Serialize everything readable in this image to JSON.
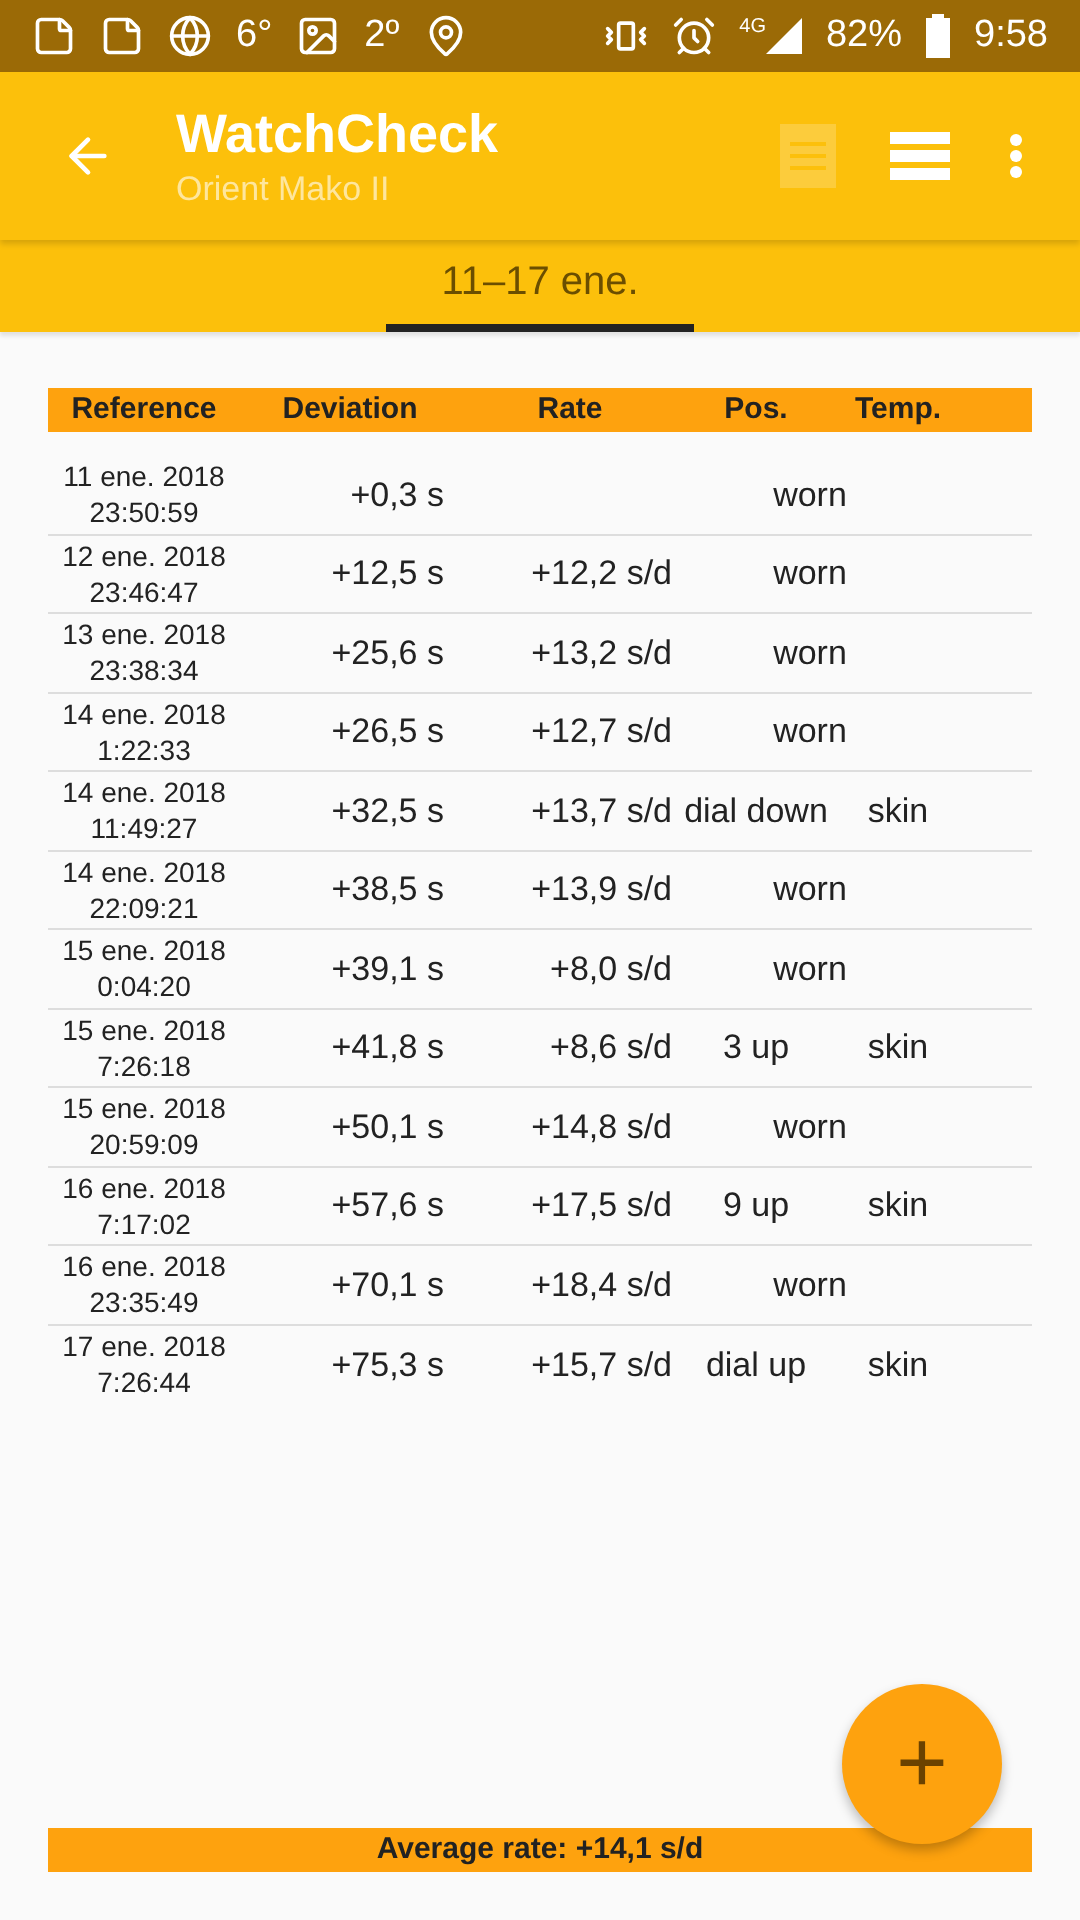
{
  "status_bar": {
    "temperature_1": "6°",
    "temperature_2": "2º",
    "battery": "82%",
    "network": "4G",
    "time": "9:58"
  },
  "app_bar": {
    "title": "WatchCheck",
    "subtitle": "Orient Mako II",
    "actions": [
      {
        "kind": "notes",
        "disabled": true
      },
      {
        "kind": "list",
        "disabled": false
      },
      {
        "kind": "more",
        "disabled": false
      }
    ]
  },
  "tabs": [
    {
      "label": "11–17 ene.",
      "selected": true
    }
  ],
  "table": {
    "columns": [
      "Reference",
      "Deviation",
      "Rate",
      "Pos.",
      "Temp."
    ],
    "rows": [
      {
        "date": "11 ene. 2018",
        "time": "23:50:59",
        "deviation": "+0,3 s",
        "pos": "worn"
      },
      {
        "date": "12 ene. 2018",
        "time": "23:46:47",
        "deviation": "+12,5 s",
        "rate": "+12,2 s/d",
        "pos": "worn"
      },
      {
        "date": "13 ene. 2018",
        "time": "23:38:34",
        "deviation": "+25,6 s",
        "rate": "+13,2 s/d",
        "pos": "worn"
      },
      {
        "date": "14 ene. 2018",
        "time": "1:22:33",
        "deviation": "+26,5 s",
        "rate": "+12,7 s/d",
        "pos": "worn"
      },
      {
        "date": "14 ene. 2018",
        "time": "11:49:27",
        "deviation": "+32,5 s",
        "rate": "+13,7 s/d",
        "pos": "dial down",
        "temp": "skin"
      },
      {
        "date": "14 ene. 2018",
        "time": "22:09:21",
        "deviation": "+38,5 s",
        "rate": "+13,9 s/d",
        "pos": "worn"
      },
      {
        "date": "15 ene. 2018",
        "time": "0:04:20",
        "deviation": "+39,1 s",
        "rate": "+8,0 s/d",
        "pos": "worn"
      },
      {
        "date": "15 ene. 2018",
        "time": "7:26:18",
        "deviation": "+41,8 s",
        "rate": "+8,6 s/d",
        "pos": "3 up",
        "temp": "skin"
      },
      {
        "date": "15 ene. 2018",
        "time": "20:59:09",
        "deviation": "+50,1 s",
        "rate": "+14,8 s/d",
        "pos": "worn"
      },
      {
        "date": "16 ene. 2018",
        "time": "7:17:02",
        "deviation": "+57,6 s",
        "rate": "+17,5 s/d",
        "pos": "9 up",
        "temp": "skin"
      },
      {
        "date": "16 ene. 2018",
        "time": "23:35:49",
        "deviation": "+70,1 s",
        "rate": "+18,4 s/d",
        "pos": "worn"
      },
      {
        "date": "17 ene. 2018",
        "time": "7:26:44",
        "deviation": "+75,3 s",
        "rate": "+15,7 s/d",
        "pos": "dial up",
        "temp": "skin"
      }
    ]
  },
  "average": "Average rate: +14,1 s/d",
  "fab": {
    "label": "+"
  }
}
